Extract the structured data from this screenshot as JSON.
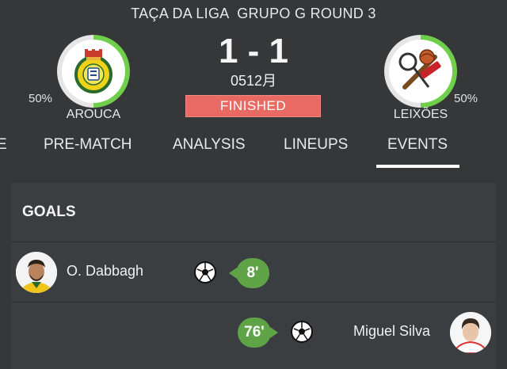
{
  "competition": {
    "title": "TAÇA DA LIGA  GRUPO G ROUND 3"
  },
  "home": {
    "name": "AROUCA",
    "percent": "50%",
    "percent_value": 50,
    "ring_color": "#6fcf4a",
    "icon": "arouca-crest-icon"
  },
  "away": {
    "name": "LEIXÕES",
    "percent": "50%",
    "percent_value": 50,
    "ring_color": "#6fcf4a",
    "icon": "leixoes-crest-icon"
  },
  "match": {
    "score": "1 - 1",
    "date": "0512月",
    "status": "FINISHED",
    "status_color": "#e86a62"
  },
  "tabs": [
    {
      "label": "E"
    },
    {
      "label": "PRE-MATCH"
    },
    {
      "label": "ANALYSIS"
    },
    {
      "label": "LINEUPS"
    },
    {
      "label": "EVENTS",
      "active": true
    }
  ],
  "events": {
    "section_title": "GOALS",
    "items": [
      {
        "side": "home",
        "player": "O. Dabbagh",
        "minute": "8'",
        "icon": "soccer-ball-icon"
      },
      {
        "side": "away",
        "player": "Miguel Silva",
        "minute": "76'",
        "icon": "soccer-ball-icon"
      }
    ]
  },
  "colors": {
    "accent_green": "#5ea447",
    "background": "#343638",
    "panel": "#3b3e41"
  }
}
